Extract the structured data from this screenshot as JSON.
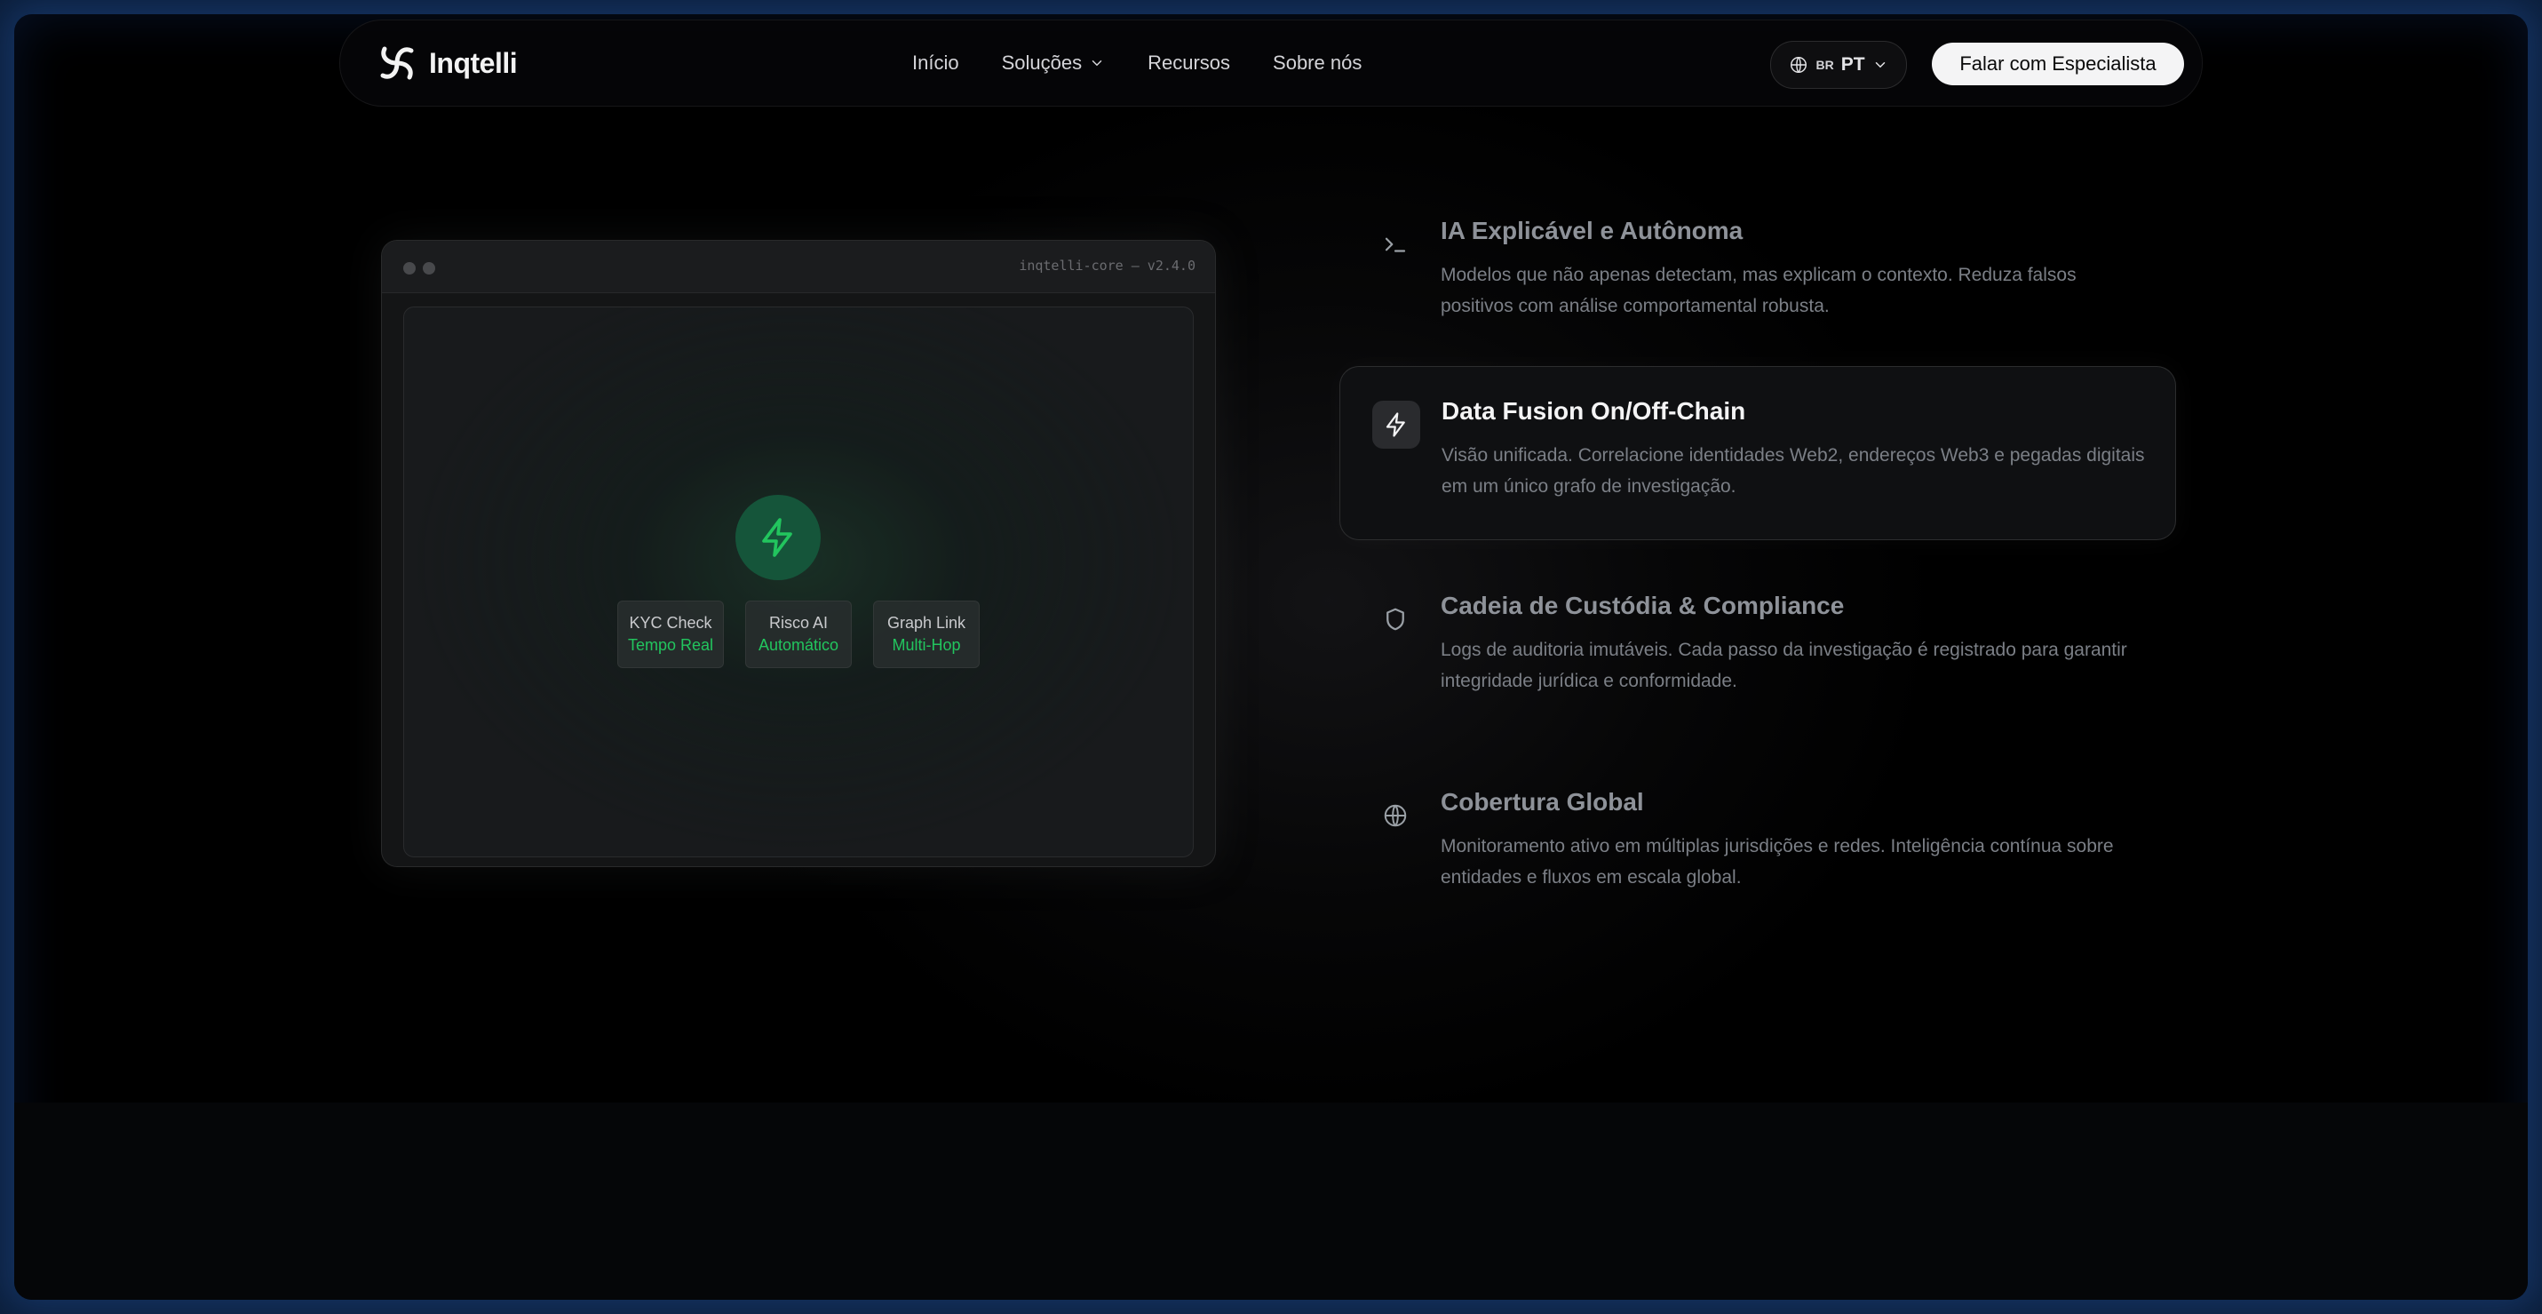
{
  "brand": {
    "name": "Inqtelli"
  },
  "nav": {
    "items": [
      {
        "label": "Início",
        "has_dropdown": false
      },
      {
        "label": "Soluções",
        "has_dropdown": true
      },
      {
        "label": "Recursos",
        "has_dropdown": false
      },
      {
        "label": "Sobre nós",
        "has_dropdown": false
      }
    ],
    "language": {
      "flag": "BR",
      "code": "PT"
    },
    "cta_label": "Falar com Especialista"
  },
  "console": {
    "title": "inqtelli-core — v2.4.0",
    "chips": [
      {
        "title": "KYC Check",
        "subtitle": "Tempo Real"
      },
      {
        "title": "Risco AI",
        "subtitle": "Automático"
      },
      {
        "title": "Graph Link",
        "subtitle": "Multi-Hop"
      }
    ]
  },
  "features": [
    {
      "icon": "terminal-icon",
      "title": "IA Explicável e Autônoma",
      "description": "Modelos que não apenas detectam, mas explicam o contexto. Reduza falsos positivos com análise comportamental robusta.",
      "active": false
    },
    {
      "icon": "lightning-icon",
      "title": "Data Fusion On/Off-Chain",
      "description": "Visão unificada. Correlacione identidades Web2, endereços Web3 e pegadas digitais em um único grafo de investigação.",
      "active": true
    },
    {
      "icon": "shield-icon",
      "title": "Cadeia de Custódia & Compliance",
      "description": "Logs de auditoria imutáveis. Cada passo da investigação é registrado para garantir integridade jurídica e conformidade.",
      "active": false
    },
    {
      "icon": "globe-icon",
      "title": "Cobertura Global",
      "description": "Monitoramento ativo em múltiplas jurisdições e redes. Inteligência contínua sobre entidades e fluxos em escala global.",
      "active": false
    }
  ],
  "colors": {
    "accent_green": "#22c55e",
    "background": "#000000",
    "frame_glow": "#1f4f9a"
  }
}
